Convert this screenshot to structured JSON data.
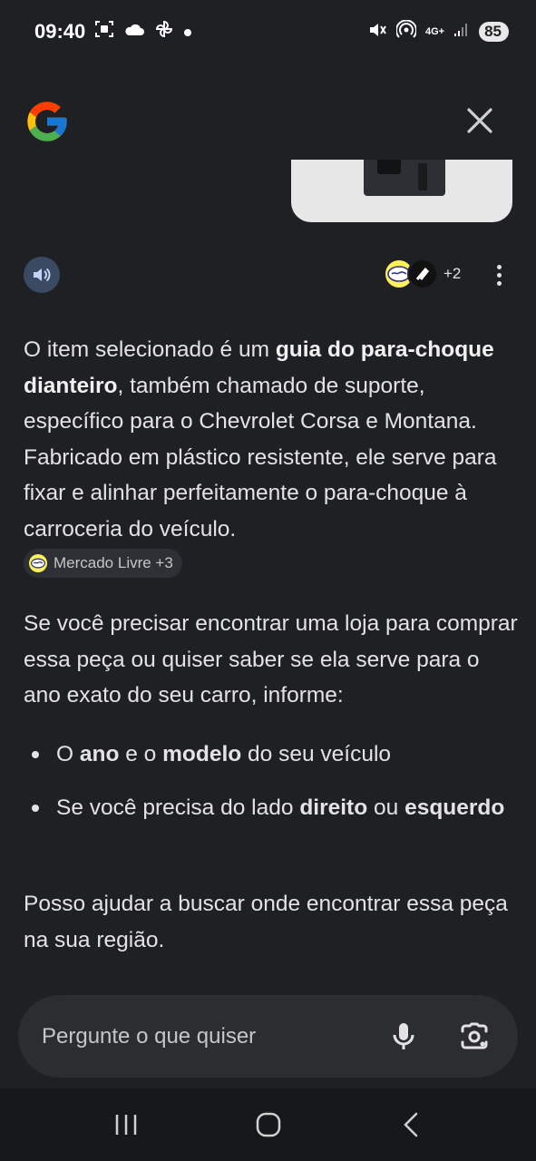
{
  "status_bar": {
    "time": "09:40",
    "battery": "85",
    "network": "4G+"
  },
  "header": {
    "logo_icon": "google-g-icon",
    "close_icon": "close-icon"
  },
  "actions": {
    "sources_more": "+2"
  },
  "answer": {
    "p1_a": "O item selecionado é um ",
    "p1_b": "guia do para-choque dianteiro",
    "p1_c": ", também chamado de suporte, específico para o Chevrolet Corsa e Montana. Fabricado em plástico resistente, ele serve para fixar e alinhar perfeitamente o para-choque à carroceria do veículo.",
    "source_chip": "Mercado Livre +3",
    "p2": "Se você precisar encontrar uma loja para comprar essa peça ou quiser saber se ela serve para o ano exato do seu carro, informe:",
    "bullet1_a": "O ",
    "bullet1_b": "ano",
    "bullet1_c": " e o ",
    "bullet1_d": "modelo",
    "bullet1_e": " do seu veículo",
    "bullet2_a": "Se você precisa do lado ",
    "bullet2_b": "direito",
    "bullet2_c": " ou ",
    "bullet2_d": "esquerdo",
    "p3": "Posso ajudar a buscar onde encontrar essa peça na sua região."
  },
  "prompt": {
    "placeholder": "Pergunte o que quiser"
  },
  "colors": {
    "background": "#1f2023",
    "text": "#e3e3e3",
    "speaker_bg": "#3b4a63",
    "prompt_bg": "#2c2d31"
  }
}
